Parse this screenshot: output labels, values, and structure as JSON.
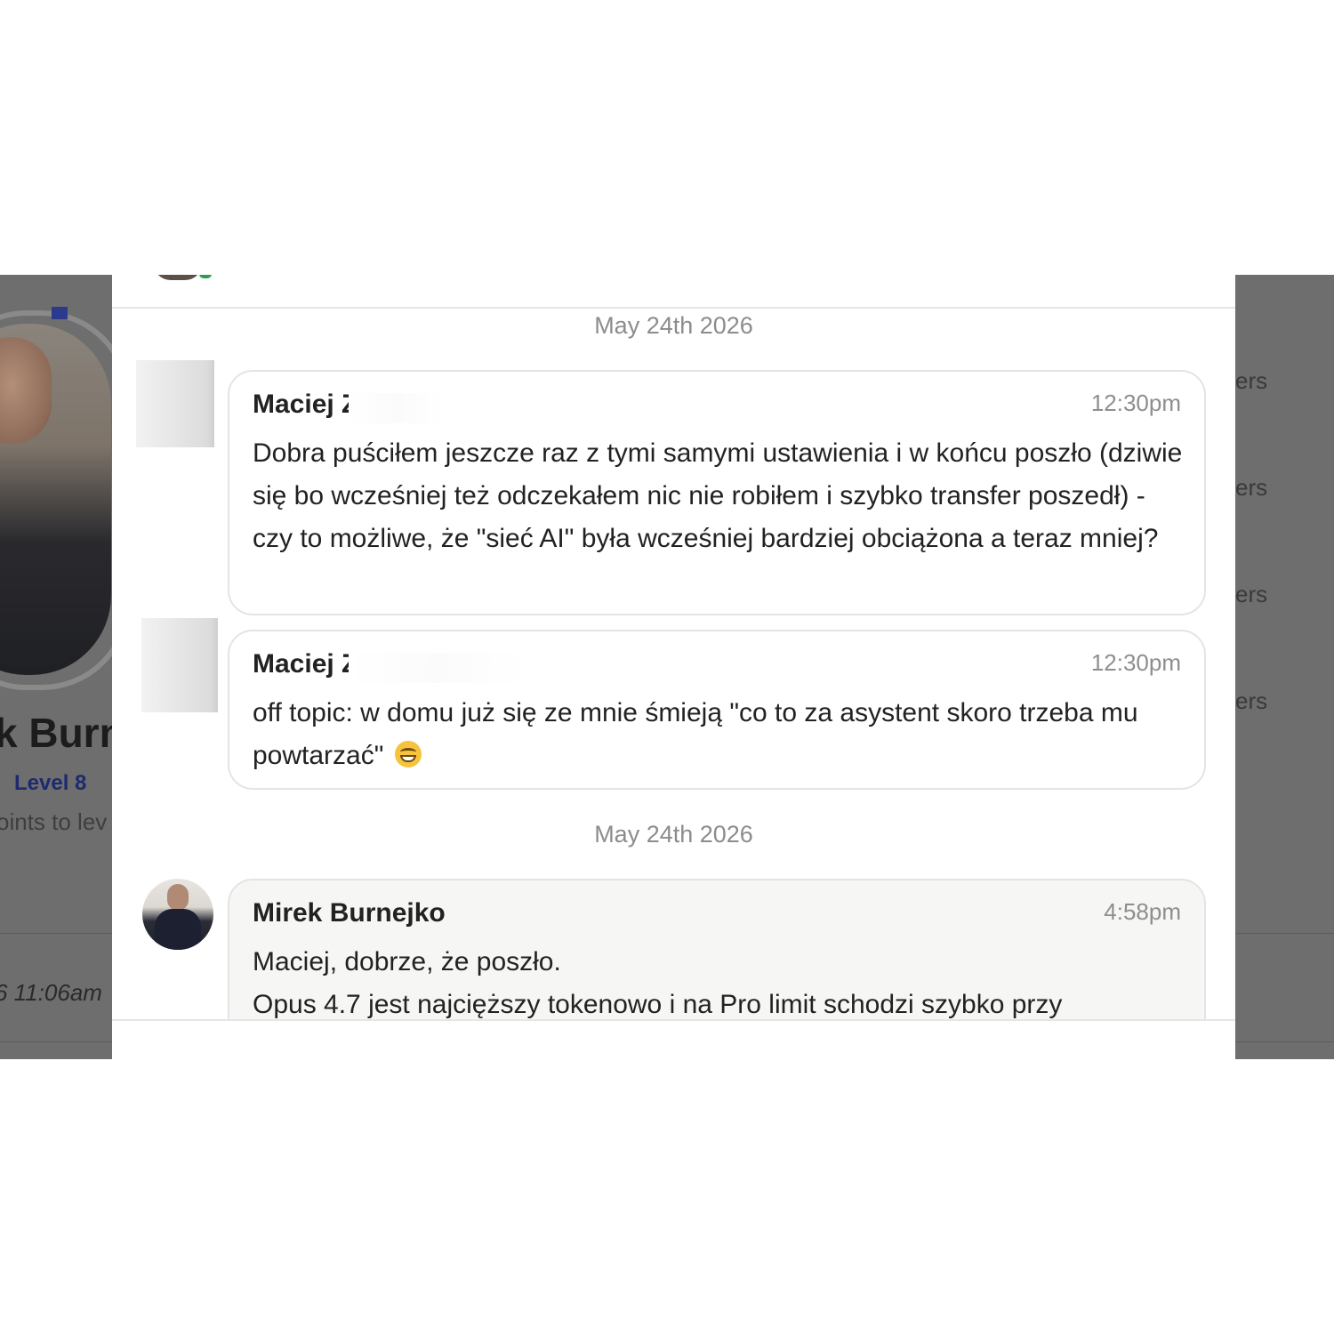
{
  "background": {
    "profile_name_fragment": "k Burn",
    "level_label": "Level 8",
    "points_fragment": "oints to lev",
    "timestamp_fragment": "6 11:06am",
    "right_fragments": [
      "ers",
      "ers",
      "ers",
      "ers"
    ]
  },
  "conversation": {
    "groups": [
      {
        "date": "May 24th 2026",
        "messages": [
          {
            "author": "Maciej Z",
            "time": "12:30pm",
            "text": "Dobra puściłem jeszcze raz z tymi samymi ustawienia i w końcu poszło (dziwie się bo wcześniej też odczekałem nic nie robiłem i szybko transfer poszedł) - czy to możliwe, że \"sieć AI\" była wcześniej bardziej obciążona a teraz mniej?"
          },
          {
            "author": "Maciej Z",
            "time": "12:30pm",
            "text": "off topic: w domu już się ze mnie śmieją \"co to za asystent skoro trzeba mu powtarzać\"",
            "emoji": "grinning-face-emoji"
          }
        ]
      },
      {
        "date": "May 24th 2026",
        "messages": [
          {
            "author": "Mirek Burnejko",
            "time": "4:58pm",
            "lines": [
              "Maciej, dobrze, że poszło.",
              "Opus 4.7 jest najcięższy tokenowo i na Pro limit schodzi szybko przy"
            ]
          }
        ]
      }
    ]
  }
}
